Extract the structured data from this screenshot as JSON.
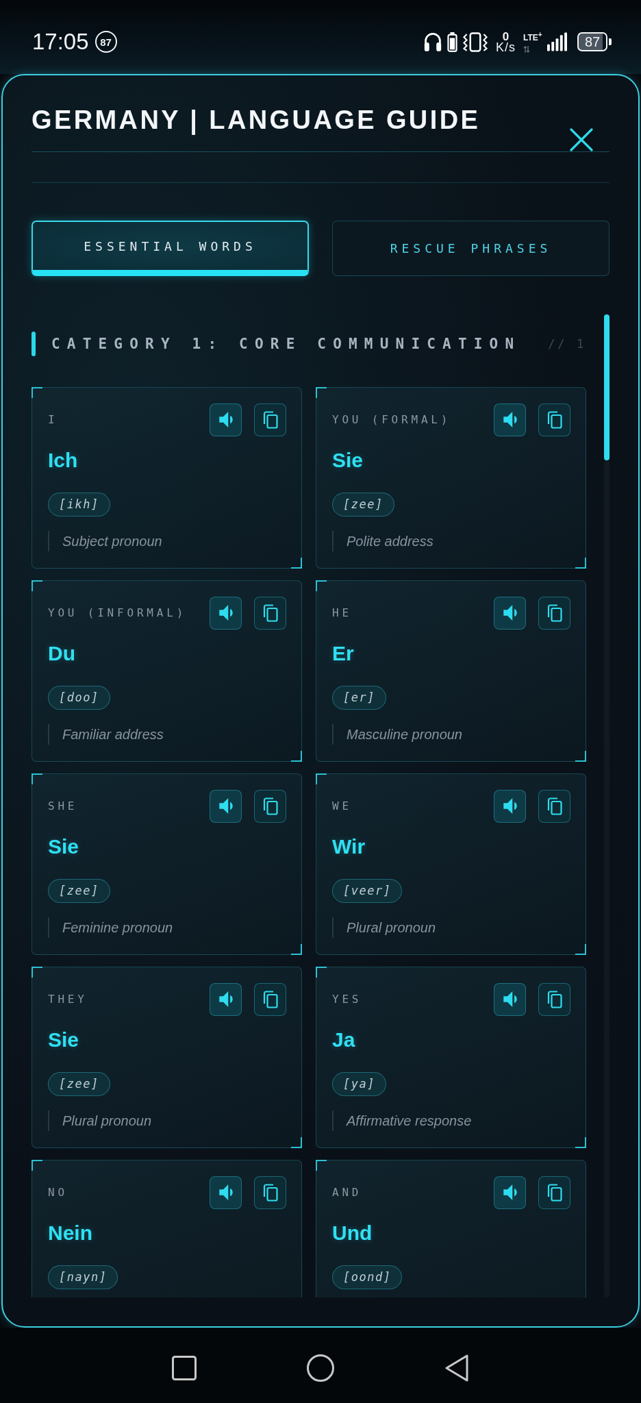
{
  "status_bar": {
    "time": "17:05",
    "notification_count": "87",
    "net_speed": "0",
    "net_speed_unit": "K/s",
    "network": "LTE$^{+}$",
    "battery": "87"
  },
  "title": "GERMANY | LANGUAGE GUIDE",
  "tabs": [
    {
      "label": "ESSENTIAL WORDS",
      "selected": true
    },
    {
      "label": "RESCUE PHRASES",
      "selected": false
    }
  ],
  "category": {
    "title": "CATEGORY 1: CORE COMMUNICATION",
    "index": "// 1"
  },
  "cards": [
    {
      "label": "I",
      "word": "Ich",
      "pronunciation": "[ikh]",
      "note": "Subject pronoun"
    },
    {
      "label": "YOU (FORMAL)",
      "word": "Sie",
      "pronunciation": "[zee]",
      "note": "Polite address"
    },
    {
      "label": "YOU (INFORMAL)",
      "word": "Du",
      "pronunciation": "[doo]",
      "note": "Familiar address"
    },
    {
      "label": "HE",
      "word": "Er",
      "pronunciation": "[er]",
      "note": "Masculine pronoun"
    },
    {
      "label": "SHE",
      "word": "Sie",
      "pronunciation": "[zee]",
      "note": "Feminine pronoun"
    },
    {
      "label": "WE",
      "word": "Wir",
      "pronunciation": "[veer]",
      "note": "Plural pronoun"
    },
    {
      "label": "THEY",
      "word": "Sie",
      "pronunciation": "[zee]",
      "note": "Plural pronoun"
    },
    {
      "label": "YES",
      "word": "Ja",
      "pronunciation": "[ya]",
      "note": "Affirmative response"
    },
    {
      "label": "NO",
      "word": "Nein",
      "pronunciation": "[nayn]"
    },
    {
      "label": "AND",
      "word": "Und",
      "pronunciation": "[oond]"
    }
  ]
}
